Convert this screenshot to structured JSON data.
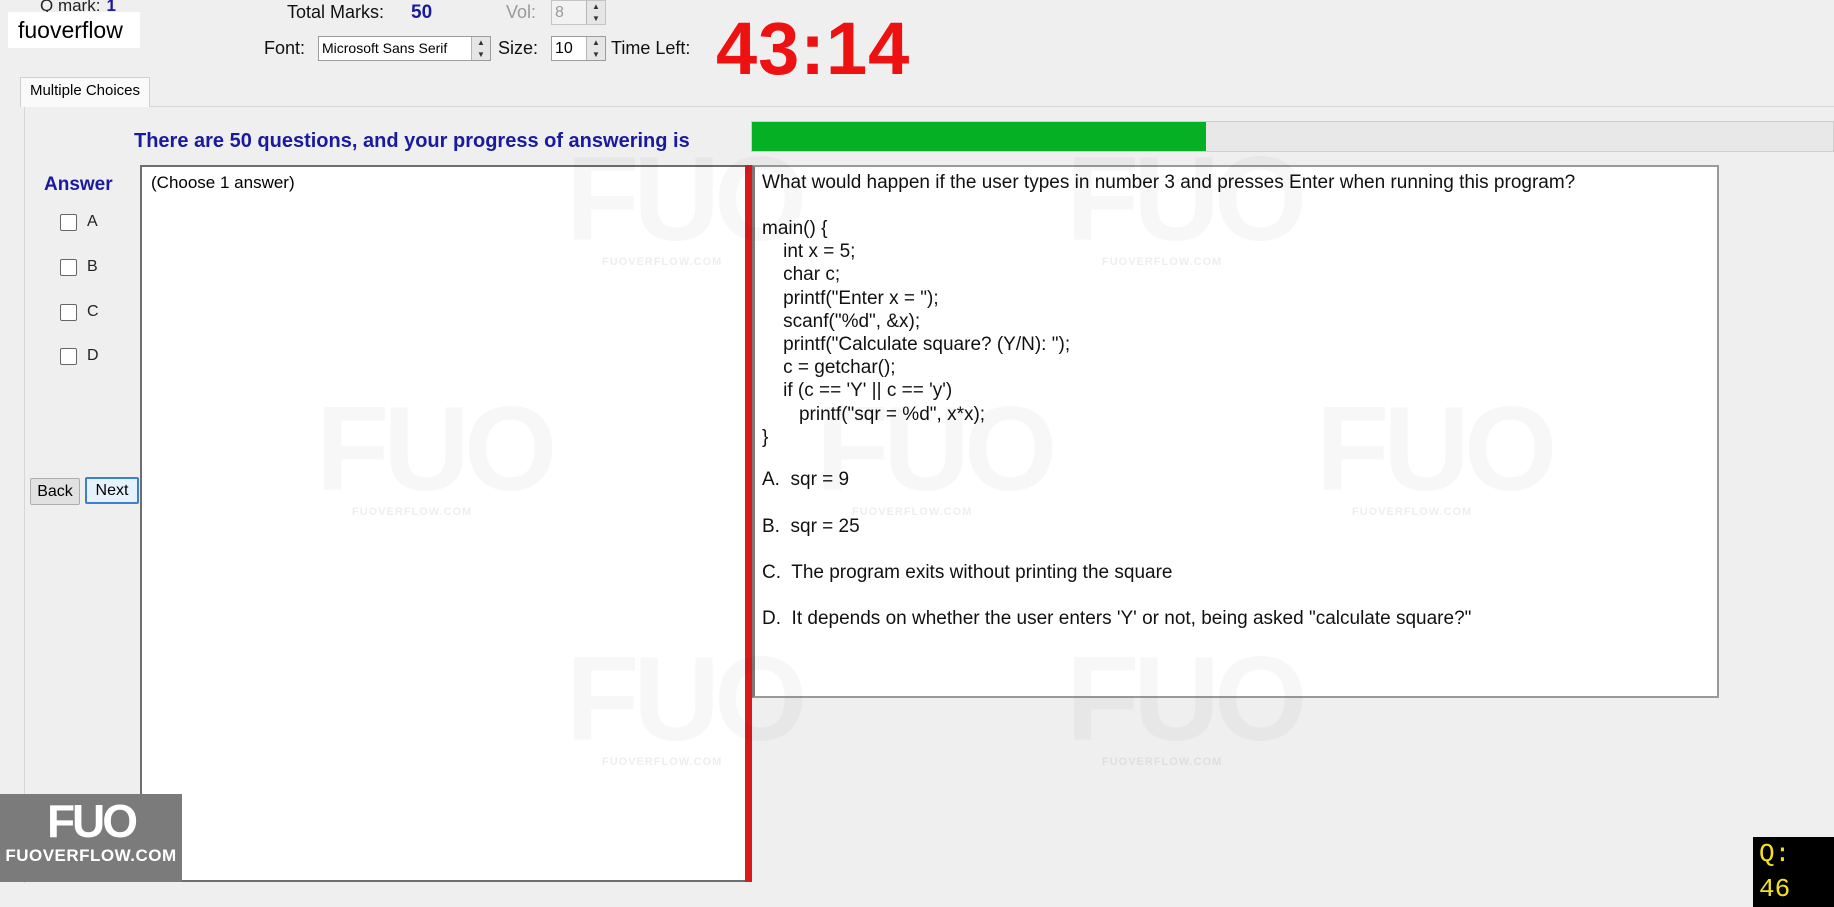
{
  "header": {
    "qmark_label": "Q mark:",
    "qmark_value": "1",
    "brand_text": "fuoverflow",
    "total_marks_label": "Total Marks:",
    "total_marks_value": "50",
    "vol_label": "Vol:",
    "vol_value": "8",
    "font_label": "Font:",
    "font_value": "Microsoft Sans Serif",
    "size_label": "Size:",
    "size_value": "10",
    "time_left_label": "Time Left:",
    "timer": "43:14"
  },
  "tabs": [
    {
      "label": "Multiple Choices",
      "active": true
    }
  ],
  "progress": {
    "text": "There are 50 questions, and your progress of answering is",
    "fraction": 0.42
  },
  "answer": {
    "title": "Answer",
    "options": [
      "A",
      "B",
      "C",
      "D"
    ],
    "back_label": "Back",
    "next_label": "Next"
  },
  "choose_hint": "(Choose 1 answer)",
  "question": {
    "prompt": "What would happen if the user types in number 3 and presses Enter when running this program?",
    "code": "main() {\n    int x = 5;\n    char c;\n    printf(\"Enter x = \");\n    scanf(\"%d\", &x);\n    printf(\"Calculate square? (Y/N): \");\n    c = getchar();\n    if (c == 'Y' || c == 'y')\n       printf(\"sqr = %d\", x*x);\n}",
    "options": [
      "A.  sqr = 9",
      "B.  sqr = 25",
      "C.  The program exits without printing the square",
      "D.  It depends on whether the user enters 'Y' or not, being asked \"calculate square?\""
    ]
  },
  "watermark": {
    "big": "FUO",
    "small": "FUOVERFLOW.COM"
  },
  "logo": {
    "big": "FUO",
    "small": "FUOVERFLOW.COM"
  },
  "question_number": "Q: 46",
  "colors": {
    "timer": "#ee1111",
    "progress": "#06b025",
    "accent_blue": "#1a1aa0",
    "divider_red": "#d91a1a"
  }
}
